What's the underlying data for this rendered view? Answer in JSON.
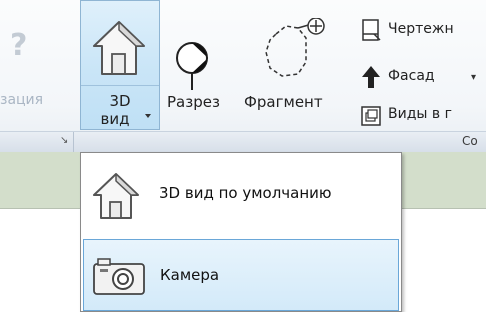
{
  "ribbon": {
    "partial_left_label": "зация",
    "buttons": {
      "view3d": {
        "line1": "3D",
        "line2": "вид"
      },
      "section": {
        "label": "Разрез"
      },
      "callout": {
        "label": "Фрагмент"
      }
    },
    "small_items": [
      {
        "label": "Чертежн",
        "icon": "drafting-view-icon"
      },
      {
        "label": "Фасад",
        "icon": "elevation-arrow-icon"
      },
      {
        "label": "Виды в г",
        "icon": "duplicate-view-icon"
      }
    ],
    "panel_bar": {
      "launcher_glyph": "↘",
      "right_title": "Со"
    }
  },
  "dropdown": {
    "items": [
      {
        "label": "3D вид по умолчанию",
        "icon": "house-icon"
      },
      {
        "label": "Камера",
        "icon": "camera-icon"
      }
    ]
  },
  "colors": {
    "selected_bg": "#d3eaf9",
    "selected_border": "#6aa7d8",
    "view_bar": "#d3decb"
  }
}
